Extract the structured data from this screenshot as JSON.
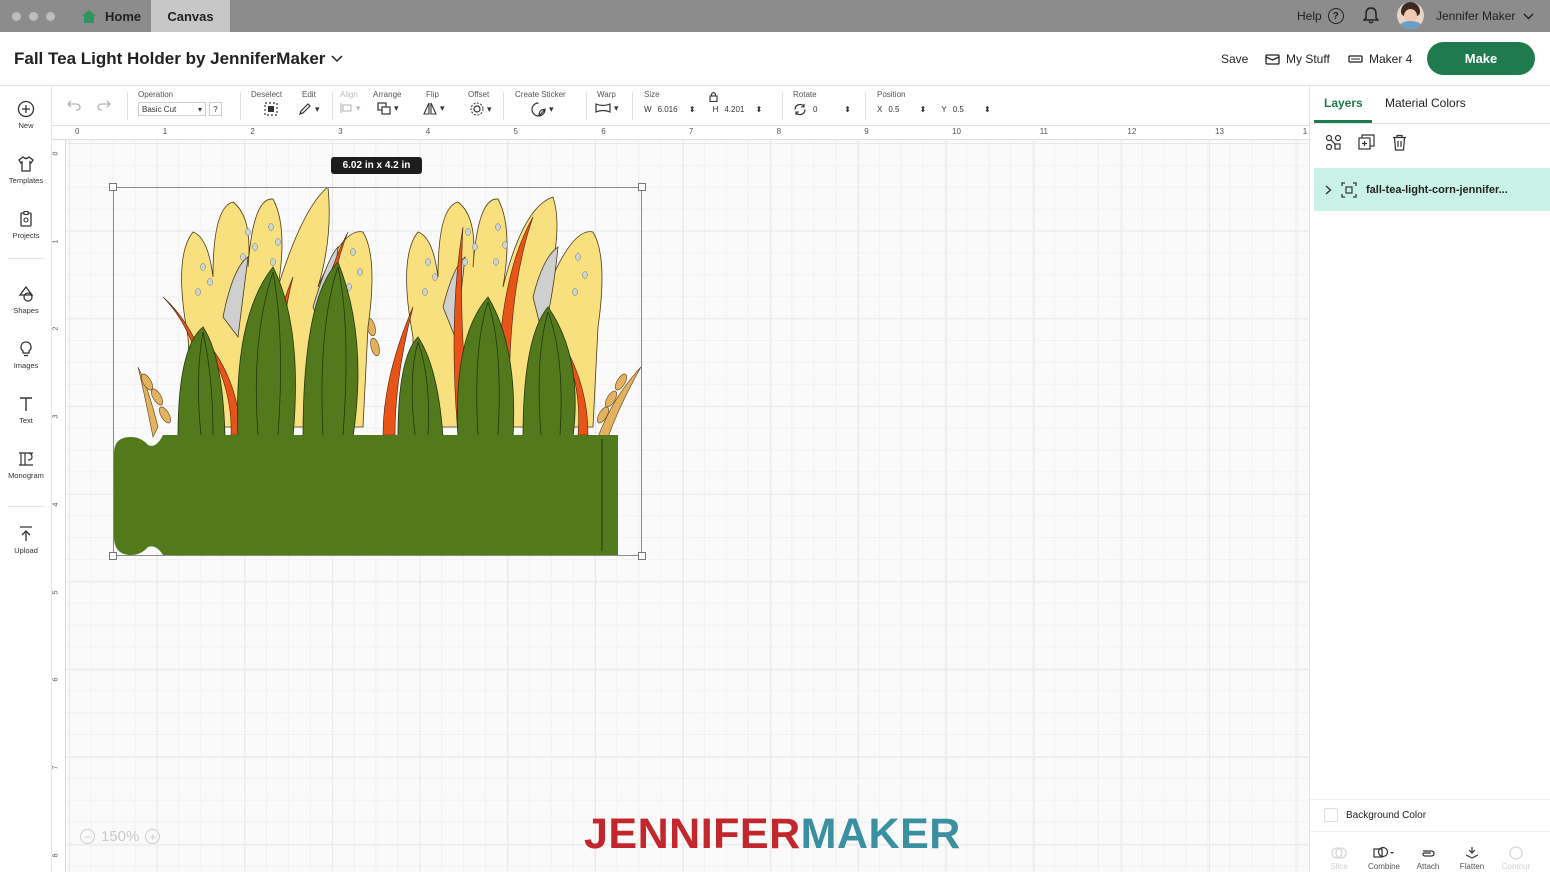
{
  "window": {
    "tabs": [
      {
        "label": "Home"
      },
      {
        "label": "Canvas"
      }
    ],
    "help_label": "Help",
    "user_name": "Jennifer Maker"
  },
  "header": {
    "project_title": "Fall Tea Light Holder by JenniferMaker",
    "save_label": "Save",
    "my_stuff_label": "My Stuff",
    "machine_label": "Maker 4",
    "make_label": "Make"
  },
  "toolbar": {
    "operation": {
      "label": "Operation",
      "value": "Basic Cut",
      "help": "?"
    },
    "deselect_label": "Deselect",
    "edit_label": "Edit",
    "align_label": "Align",
    "arrange_label": "Arrange",
    "flip_label": "Flip",
    "offset_label": "Offset",
    "create_sticker_label": "Create Sticker",
    "warp_label": "Warp",
    "size": {
      "label": "Size",
      "w_label": "W",
      "w_value": "6.016",
      "h_label": "H",
      "h_value": "4.201"
    },
    "rotate": {
      "label": "Rotate",
      "value": "0"
    },
    "position": {
      "label": "Position",
      "x_label": "X",
      "x_value": "0.5",
      "y_label": "Y",
      "y_value": "0.5"
    }
  },
  "sidebar": {
    "items": [
      {
        "label": "New",
        "icon": "plus-circle-icon"
      },
      {
        "label": "Templates",
        "icon": "shirt-icon"
      },
      {
        "label": "Projects",
        "icon": "clipboard-icon"
      },
      {
        "label": "Shapes",
        "icon": "shapes-icon"
      },
      {
        "label": "Images",
        "icon": "bulb-icon"
      },
      {
        "label": "Text",
        "icon": "text-icon"
      },
      {
        "label": "Monogram",
        "icon": "monogram-icon"
      },
      {
        "label": "Upload",
        "icon": "upload-icon"
      }
    ]
  },
  "rulers": {
    "top": [
      "0",
      "1",
      "2",
      "3",
      "4",
      "5",
      "6",
      "7",
      "8",
      "9",
      "10",
      "11",
      "12",
      "13",
      "1"
    ],
    "left": [
      "0",
      "1",
      "2",
      "3",
      "4",
      "5",
      "6",
      "7",
      "8"
    ]
  },
  "canvas": {
    "selection_size": "6.02  in x 4.2  in",
    "zoom": "150%",
    "watermark_a": "JENNIFER",
    "watermark_b": "MAKER"
  },
  "panel": {
    "tabs": [
      {
        "label": "Layers",
        "active": true
      },
      {
        "label": "Material Colors",
        "active": false
      }
    ],
    "layer_name": "fall-tea-light-corn-jennifer...",
    "background_color_label": "Background Color",
    "bottom_tools": [
      {
        "label": "Slice",
        "enabled": false
      },
      {
        "label": "Combine",
        "enabled": true
      },
      {
        "label": "Attach",
        "enabled": true
      },
      {
        "label": "Flatten",
        "enabled": true
      },
      {
        "label": "Contour",
        "enabled": false
      }
    ]
  },
  "colors": {
    "make_button": "#1f7a4d",
    "layer_highlight": "#c9f1e6",
    "green_dark": "#527a1d",
    "orange": "#e85418",
    "yellow": "#f9e07e"
  }
}
